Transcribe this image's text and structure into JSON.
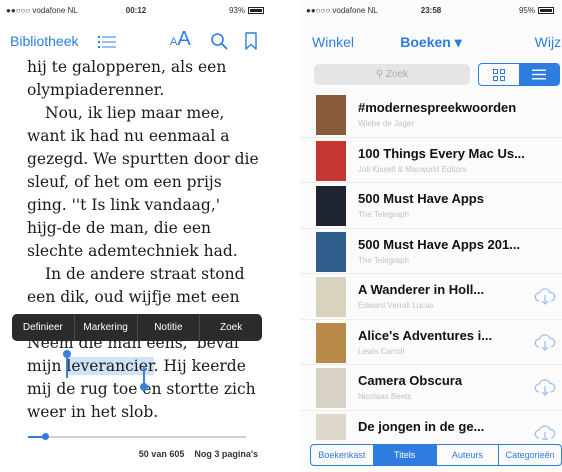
{
  "reader": {
    "status": {
      "carrier": "●●○○○ vodafone NL",
      "time": "00:12",
      "battery": "93%"
    },
    "toolbar": {
      "library_label": "Bibliotheek",
      "font_label_small": "A",
      "font_label_large": "A"
    },
    "text": {
      "p1": "hij te galopperen, als een olympiaderenner.",
      "p2": "Nou, ik liep maar mee, want ik had nu eenmaal a gezegd. We spurtten door die sleuf, of het om een prijs ging. ''t Is link vandaag,' hijg-de de man, die een slechte ademtechniek had.",
      "p3": "In de andere straat stond een dik, oud wijfje met een",
      "p4_before": "Neem die man eens,' beval mijn ",
      "p4_highlight": "leverancier",
      "p4_after": ". Hij keerde mij de rug toe en stortte zich weer in het slob."
    },
    "context_menu": [
      "Definieer",
      "Markering",
      "Notitie",
      "Zoek"
    ],
    "progress": {
      "fraction": 0.08,
      "page_label": "50 van 605",
      "remaining_label": "Nog 3 pagina's"
    }
  },
  "library": {
    "status": {
      "carrier": "●●○○○ vodafone NL",
      "time": "23:58",
      "battery": "95%"
    },
    "nav": {
      "store_label": "Winkel",
      "title": "Boeken ▾",
      "edit_label": "Wijzig"
    },
    "search_placeholder": "Zoek",
    "books": [
      {
        "title": "#modernespreekwoorden",
        "author": "Wiebe de Jager",
        "cloud": false,
        "cover_color": "#8a5b3a"
      },
      {
        "title": "100 Things Every Mac Us...",
        "author": "Joli Kissell & Macworld Editors",
        "cloud": false,
        "cover_color": "#c4362f"
      },
      {
        "title": "500 Must Have Apps",
        "author": "The Telegraph",
        "cloud": false,
        "cover_color": "#1e2430"
      },
      {
        "title": "500 Must Have Apps 201...",
        "author": "The Telegraph",
        "cloud": false,
        "cover_color": "#2f5f8a"
      },
      {
        "title": "A Wanderer in Holl...",
        "author": "Edward Verrall Lucas",
        "cloud": true,
        "cover_color": "#d9d3bd"
      },
      {
        "title": "Alice's Adventures i...",
        "author": "Lewis Carroll",
        "cloud": true,
        "cover_color": "#b88a4a"
      },
      {
        "title": "Camera Obscura",
        "author": "Nicolaas Beets",
        "cloud": true,
        "cover_color": "#d7d2c4"
      },
      {
        "title": "De jongen in de ge...",
        "author": "",
        "cloud": true,
        "cover_color": "#ddd8ca"
      }
    ],
    "tabs": [
      "Boekenkast",
      "Titels",
      "Auteurs",
      "Categorieën"
    ],
    "active_tab": "Titels"
  }
}
